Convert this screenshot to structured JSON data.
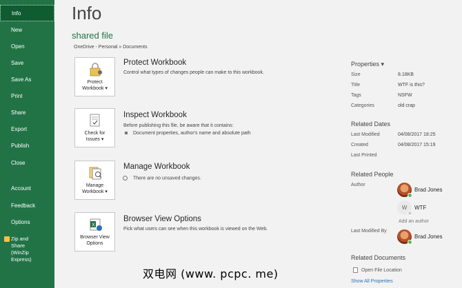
{
  "sidebar": {
    "items": [
      {
        "label": "Info"
      },
      {
        "label": "New"
      },
      {
        "label": "Open"
      },
      {
        "label": "Save"
      },
      {
        "label": "Save As"
      },
      {
        "label": "Print"
      },
      {
        "label": "Share"
      },
      {
        "label": "Export"
      },
      {
        "label": "Publish"
      },
      {
        "label": "Close"
      },
      {
        "label": "Account"
      },
      {
        "label": "Feedback"
      },
      {
        "label": "Options"
      }
    ],
    "zip_lines": [
      "Zip and",
      "Share",
      "(WinZip",
      "Express)"
    ]
  },
  "main": {
    "title": "Info",
    "file_name": "shared file",
    "file_path": "OneDrive - Personal » Documents",
    "sections": [
      {
        "button_lines": [
          "Protect",
          "Workbook ▾"
        ],
        "title": "Protect Workbook",
        "description": "Control what types of changes people can make to this workbook."
      },
      {
        "button_lines": [
          "Check for",
          "Issues ▾"
        ],
        "title": "Inspect Workbook",
        "description": "Before publishing this file, be aware that it contains:",
        "bullet": "Document properties, author's name and absolute path"
      },
      {
        "button_lines": [
          "Manage",
          "Workbook ▾"
        ],
        "title": "Manage Workbook",
        "bullet": "There are no unsaved changes."
      },
      {
        "button_lines": [
          "Browser View",
          "Options"
        ],
        "title": "Browser View Options",
        "description": "Pick what users can see when this workbook is viewed on the Web."
      }
    ]
  },
  "properties": {
    "heading": "Properties ▾",
    "rows": [
      {
        "key": "Size",
        "value": "8.18KB"
      },
      {
        "key": "Title",
        "value": "WTF is this?"
      },
      {
        "key": "Tags",
        "value": "NSFW"
      },
      {
        "key": "Categories",
        "value": "old crap"
      }
    ],
    "related_dates": {
      "heading": "Related Dates",
      "rows": [
        {
          "key": "Last Modified",
          "value": "04/08/2017 18:25"
        },
        {
          "key": "Created",
          "value": "04/08/2017 15:19"
        },
        {
          "key": "Last Printed",
          "value": ""
        }
      ]
    },
    "related_people": {
      "heading": "Related People",
      "author_label": "Author",
      "authors": [
        {
          "name": "Brad Jones",
          "initial": ""
        },
        {
          "name": "WTF",
          "initial": "W"
        }
      ],
      "add_author": "Add an author",
      "last_modified_by_label": "Last Modified By",
      "last_modified_by": "Brad Jones"
    },
    "related_documents": {
      "heading": "Related Documents",
      "open_location": "Open File Location",
      "show_all": "Show All Properties"
    }
  },
  "watermark": "双电网 (www. pcpc. me)",
  "colors": {
    "accent": "#217346",
    "sidebar_active": "#0e5c30",
    "link": "#2b6fb6"
  }
}
